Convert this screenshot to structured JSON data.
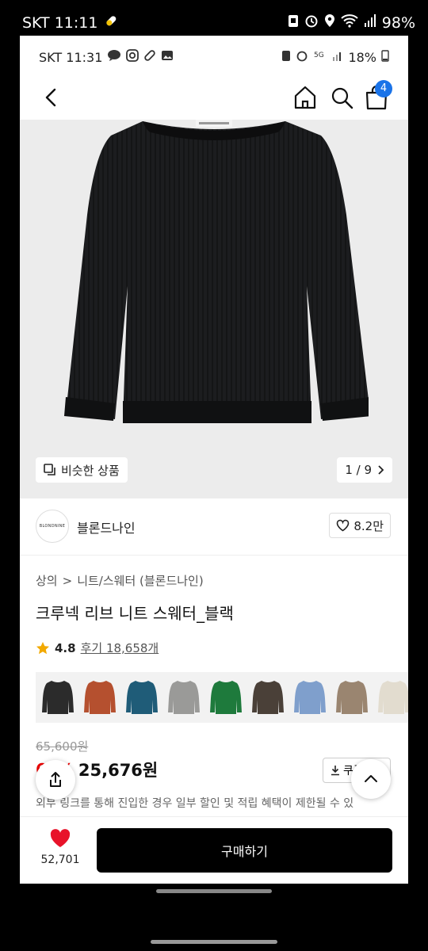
{
  "outer_status": {
    "carrier_time": "SKT 11:11",
    "battery": "98%"
  },
  "inner_status": {
    "carrier_time": "SKT 11:31",
    "battery": "18%"
  },
  "header": {
    "cart_count": "4"
  },
  "hero": {
    "similar_label": "비슷한 상품",
    "pager": "1 / 9"
  },
  "brand": {
    "logo_text": "BLONDNINE",
    "name": "블론드나인",
    "likes": "8.2만"
  },
  "breadcrumb": {
    "category": "상의",
    "separator": ">",
    "subcategory": "니트/스웨터 (블론드나인)"
  },
  "product": {
    "title": "크루넥 리브 니트 스웨터_블랙",
    "rating": "4.8",
    "reviews": "후기 18,658개"
  },
  "swatches": [
    {
      "color": "#2b2b2b"
    },
    {
      "color": "#b5502f"
    },
    {
      "color": "#1f5c78"
    },
    {
      "color": "#9a9a98"
    },
    {
      "color": "#1e7a3c"
    },
    {
      "color": "#4a4038"
    },
    {
      "color": "#7f9fcc"
    },
    {
      "color": "#9a8570"
    },
    {
      "color": "#e2dccf"
    },
    {
      "color": "#111111"
    }
  ],
  "pricing": {
    "original": "65,600원",
    "discount": "61%",
    "price": "25,676원",
    "coupon_label": "쿠폰"
  },
  "notice": "외부 링크를 통해 진입한 경우 일부 할인 및 적립 혜택이 제한될 수 있",
  "bottom": {
    "wishlist_count": "52,701",
    "buy_label": "구매하기"
  },
  "colors": {
    "accent_blue": "#1a73e8",
    "sale_red": "#ee0000",
    "buy_bg": "#000000"
  }
}
